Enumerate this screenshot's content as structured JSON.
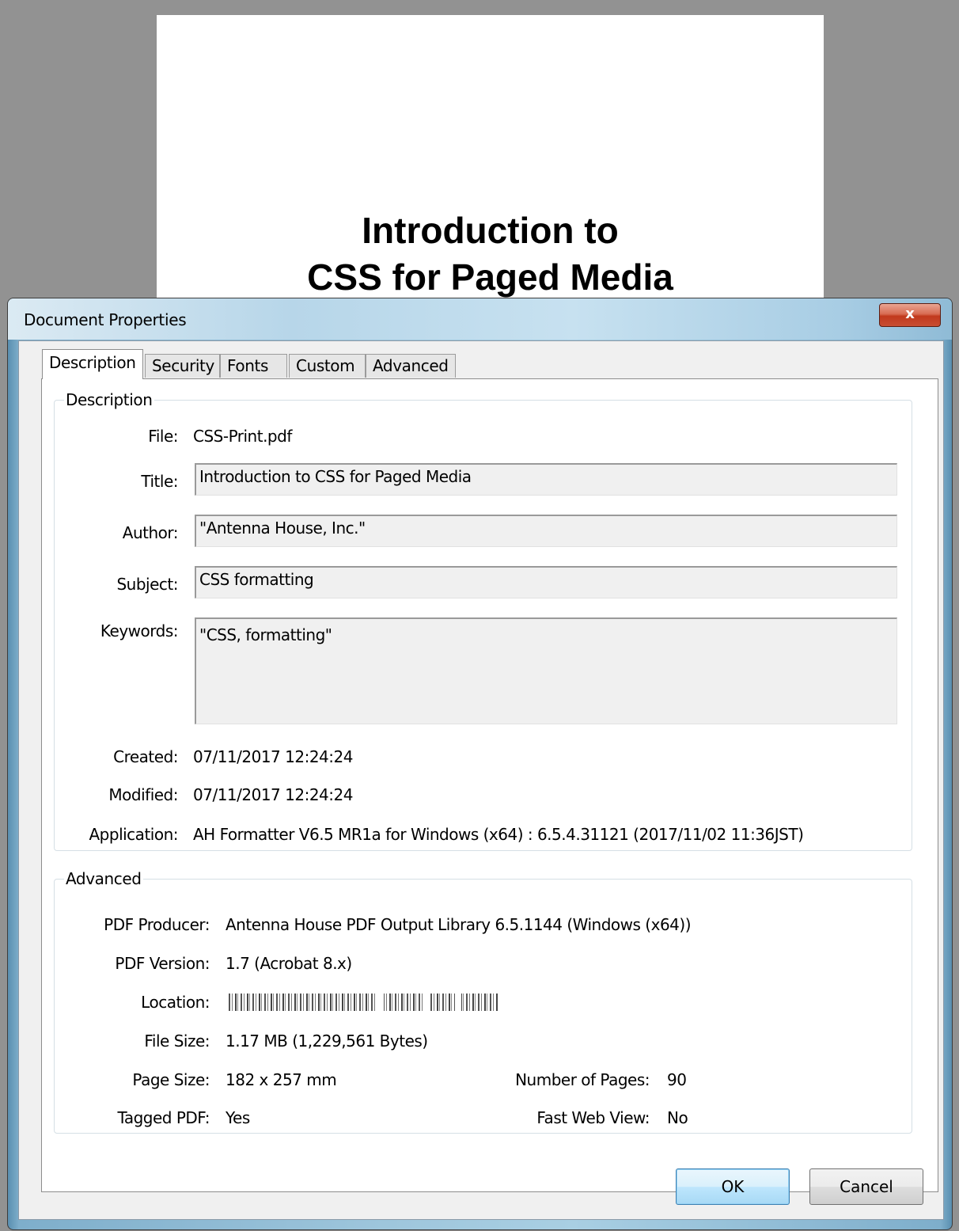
{
  "background_document": {
    "title_line1": "Introduction to",
    "title_line2": "CSS for Paged Media"
  },
  "dialog": {
    "title": "Document Properties",
    "close_label": "x",
    "tabs": [
      {
        "label": "Description",
        "active": true
      },
      {
        "label": "Security",
        "active": false
      },
      {
        "label": "Fonts",
        "active": false
      },
      {
        "label": "Custom",
        "active": false
      },
      {
        "label": "Advanced",
        "active": false
      }
    ],
    "description": {
      "section_label": "Description",
      "file_label": "File:",
      "file_value": "CSS-Print.pdf",
      "title_label": "Title:",
      "title_value": "Introduction to CSS for Paged Media",
      "author_label": "Author:",
      "author_value": "\"Antenna House, Inc.\"",
      "subject_label": "Subject:",
      "subject_value": "CSS formatting",
      "keywords_label": "Keywords:",
      "keywords_value": "\"CSS, formatting\"",
      "created_label": "Created:",
      "created_value": "07/11/2017 12:24:24",
      "modified_label": "Modified:",
      "modified_value": "07/11/2017 12:24:24",
      "application_label": "Application:",
      "application_value": "AH Formatter V6.5 MR1a for Windows (x64) : 6.5.4.31121 (2017/11/02 11:36JST)"
    },
    "advanced": {
      "section_label": "Advanced",
      "producer_label": "PDF Producer:",
      "producer_value": "Antenna House PDF Output Library 6.5.1144 (Windows (x64))",
      "version_label": "PDF Version:",
      "version_value": "1.7 (Acrobat 8.x)",
      "location_label": "Location:",
      "filesize_label": "File Size:",
      "filesize_value": "1.17 MB (1,229,561 Bytes)",
      "pagesize_label": "Page Size:",
      "pagesize_value": "182 x 257 mm",
      "numpages_label": "Number of Pages:",
      "numpages_value": "90",
      "tagged_label": "Tagged PDF:",
      "tagged_value": "Yes",
      "fastweb_label": "Fast Web View:",
      "fastweb_value": "No"
    },
    "buttons": {
      "ok_label": "OK",
      "cancel_label": "Cancel"
    }
  }
}
